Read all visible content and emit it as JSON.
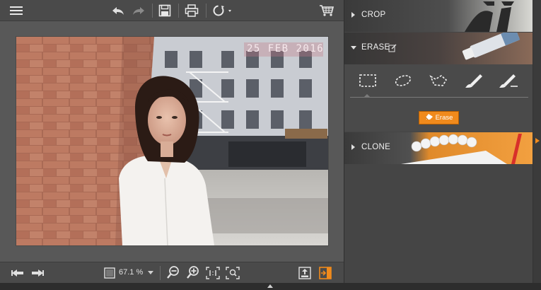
{
  "toolbar": {
    "menu_icon": "hamburger-icon",
    "undo_icon": "undo-icon",
    "redo_icon": "redo-icon",
    "save_icon": "save-icon",
    "print_icon": "print-icon",
    "share_icon": "share-icon",
    "cart_icon": "cart-icon"
  },
  "photo": {
    "date_stamp": "25 FEB 2016"
  },
  "statusbar": {
    "zoom_value": "67.1 %",
    "prev_icon": "previous-image-icon",
    "next_icon": "next-image-icon"
  },
  "panels": {
    "crop": {
      "label": "CROP"
    },
    "erase": {
      "label": "ERASE",
      "button_label": "Erase"
    },
    "clone": {
      "label": "CLONE"
    }
  },
  "colors": {
    "accent": "#f08a1c",
    "panel_bg": "#454545",
    "workspace_bg": "#585858"
  }
}
